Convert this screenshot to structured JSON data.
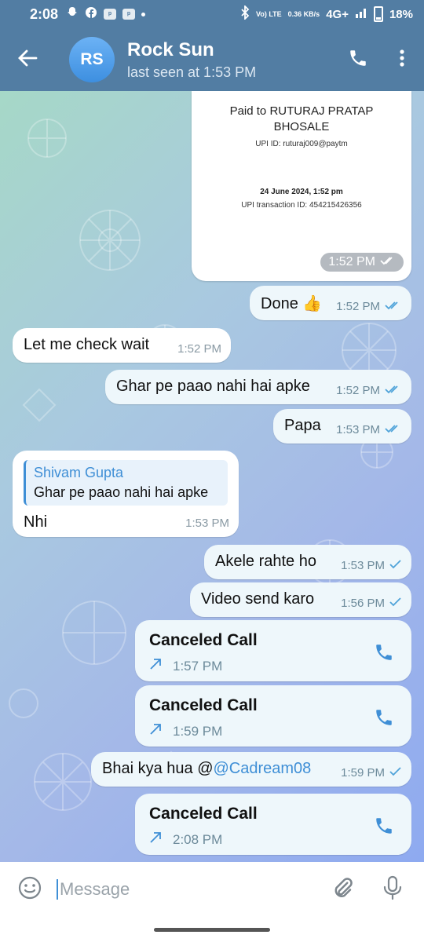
{
  "status_bar": {
    "time": "2:08",
    "network": "Vo) LTE",
    "speed": "0.36 KB/s",
    "signal": "4G+",
    "battery": "18%"
  },
  "header": {
    "avatar_initials": "RS",
    "name": "Rock Sun",
    "status": "last seen at 1:53 PM"
  },
  "payment_card": {
    "paid_to": "Paid to RUTURAJ PRATAP BHOSALE",
    "upi_id": "UPI ID: ruturaj009@paytm",
    "date": "24 June 2024, 1:52 pm",
    "transaction": "UPI transaction ID: 454215426356",
    "time": "1:52 PM"
  },
  "messages": [
    {
      "text": "Done 👍",
      "time": "1:52 PM",
      "direction": "out"
    },
    {
      "text": "Let me check wait",
      "time": "1:52 PM",
      "direction": "in"
    },
    {
      "text": "Ghar pe paao nahi hai apke",
      "time": "1:52 PM",
      "direction": "out"
    },
    {
      "text": "Papa",
      "time": "1:53 PM",
      "direction": "out"
    },
    {
      "text": "Nhi",
      "time": "1:53 PM",
      "direction": "in",
      "reply_name": "Shivam Gupta",
      "reply_text": "Ghar pe paao nahi hai apke"
    },
    {
      "text": "Akele rahte ho",
      "time": "1:53 PM",
      "direction": "out"
    },
    {
      "text": "Video send karo",
      "time": "1:56 PM",
      "direction": "out"
    },
    {
      "text": "Canceled Call",
      "time": "1:57 PM",
      "direction": "out"
    },
    {
      "text": "Canceled Call",
      "time": "1:59 PM",
      "direction": "out"
    },
    {
      "text_prefix": "Bhai kya hua @",
      "mention": "@Cadream08",
      "time": "1:59 PM",
      "direction": "out"
    },
    {
      "text": "Canceled Call",
      "time": "2:08 PM",
      "direction": "out"
    }
  ],
  "composer": {
    "placeholder": "Message"
  },
  "colors": {
    "header_bg": "#527da3",
    "accent": "#3f8fd6",
    "out_bubble": "#eef7fb",
    "in_bubble": "#ffffff",
    "read_ticks": "#4fa3d9"
  }
}
